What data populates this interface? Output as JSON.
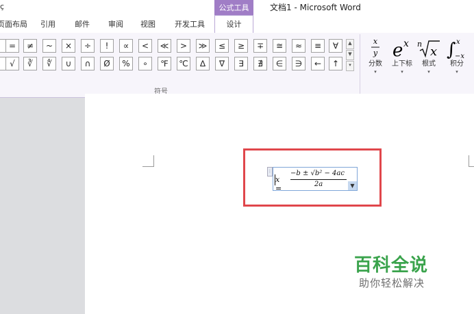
{
  "title_bar": {
    "left_fragment": "ç",
    "context_tab_group": "公式工具",
    "document_title": "文档1 - Microsoft Word"
  },
  "tabs": [
    {
      "label": "页面布局"
    },
    {
      "label": "引用"
    },
    {
      "label": "邮件"
    },
    {
      "label": "审阅"
    },
    {
      "label": "视图"
    },
    {
      "label": "开发工具"
    },
    {
      "label": "设计",
      "active": true
    }
  ],
  "symbols": {
    "row1": [
      "",
      "=",
      "≠",
      "~",
      "×",
      "÷",
      "!",
      "∝",
      "<",
      "≪",
      ">",
      "≫",
      "≤",
      "≥",
      "∓",
      "≅",
      "≈",
      "≡",
      "∀"
    ],
    "row2": [
      "",
      "√",
      "∛",
      "∜",
      "∪",
      "∩",
      "Ø",
      "%",
      "∘",
      "℉",
      "℃",
      "∆",
      "∇",
      "∃",
      "∄",
      "∈",
      "∋",
      "←",
      "↑"
    ],
    "group_label": "符号"
  },
  "structures": [
    {
      "label": "分数",
      "icon": "fraction-icon"
    },
    {
      "label": "上下标",
      "icon": "script-icon"
    },
    {
      "label": "根式",
      "icon": "radical-icon"
    },
    {
      "label": "积分",
      "icon": "integral-icon"
    }
  ],
  "equation": {
    "lhs": "x =",
    "numerator": "−b ± √b² − 4ac",
    "denominator": "2a"
  },
  "watermark": {
    "main": "百科全说",
    "sub": "助你轻松解决"
  },
  "colors": {
    "context_tab": "#a07dc6",
    "highlight_box": "#e0464b",
    "watermark_green": "#3aa34c"
  }
}
